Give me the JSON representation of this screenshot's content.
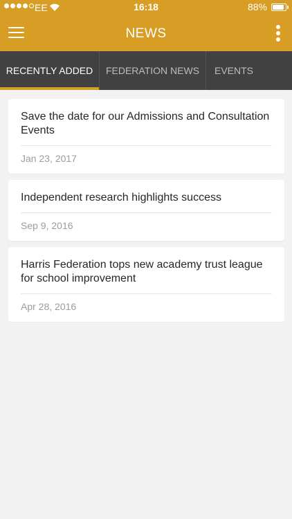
{
  "status_bar": {
    "carrier": "EE",
    "time": "16:18",
    "battery": "88%",
    "battery_level": 0.88
  },
  "app_bar": {
    "title": "NEWS",
    "menu_icon": "hamburger-menu-icon",
    "more_icon": "vertical-dots-icon"
  },
  "tabs": [
    {
      "label": "RECENTLY ADDED",
      "active": true
    },
    {
      "label": "FEDERATION NEWS",
      "active": false
    },
    {
      "label": "EVENTS",
      "active": false
    }
  ],
  "news": [
    {
      "title": "Save the date for our Admissions and Consultation Events",
      "date": "Jan 23, 2017"
    },
    {
      "title": "Independent research highlights success",
      "date": "Sep 9, 2016"
    },
    {
      "title": "Harris Federation tops new academy trust league for school improvement",
      "date": "Apr 28, 2016"
    }
  ],
  "colors": {
    "brand": "#d89d25",
    "tab_bar": "#414141",
    "background": "#f2f2f2"
  }
}
